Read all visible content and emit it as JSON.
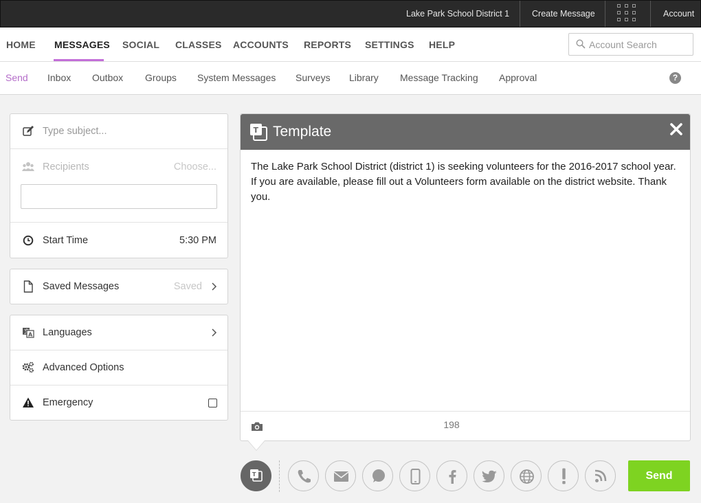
{
  "topbar": {
    "district": "Lake Park School District 1",
    "create_message": "Create Message",
    "apps_icon": "grid-icon",
    "account": "Account"
  },
  "main_nav": {
    "items": [
      "HOME",
      "MESSAGES",
      "SOCIAL",
      "CLASSES",
      "ACCOUNTS",
      "REPORTS",
      "SETTINGS",
      "HELP"
    ],
    "active": "MESSAGES",
    "search_placeholder": "Account Search"
  },
  "sub_nav": {
    "items": [
      "Send",
      "Inbox",
      "Outbox",
      "Groups",
      "System Messages",
      "Surveys",
      "Library",
      "Message Tracking",
      "Approval"
    ],
    "active": "Send",
    "help_icon": "?"
  },
  "compose": {
    "subject_placeholder": "Type subject...",
    "recipients_label": "Recipients",
    "recipients_action": "Choose...",
    "start_time_label": "Start Time",
    "start_time_value": "5:30 PM"
  },
  "saved": {
    "label": "Saved Messages",
    "status": "Saved"
  },
  "options": {
    "languages": "Languages",
    "advanced": "Advanced Options",
    "emergency": "Emergency"
  },
  "template": {
    "title": "Template",
    "body": "The Lake Park School District (district 1) is seeking volunteers for the 2016-2017 school year. If you are available, please fill out a Volunteers form available on the district website. Thank you.",
    "char_count": "198"
  },
  "channels": [
    "template-icon",
    "phone-icon",
    "email-icon",
    "chat-icon",
    "mobile-icon",
    "facebook-icon",
    "twitter-icon",
    "web-icon",
    "alert-icon",
    "rss-icon"
  ],
  "send_label": "Send",
  "colors": {
    "accent": "#c36fd9",
    "send": "#7ed321",
    "topbar": "#2a2a2a",
    "template_header": "#696969"
  }
}
